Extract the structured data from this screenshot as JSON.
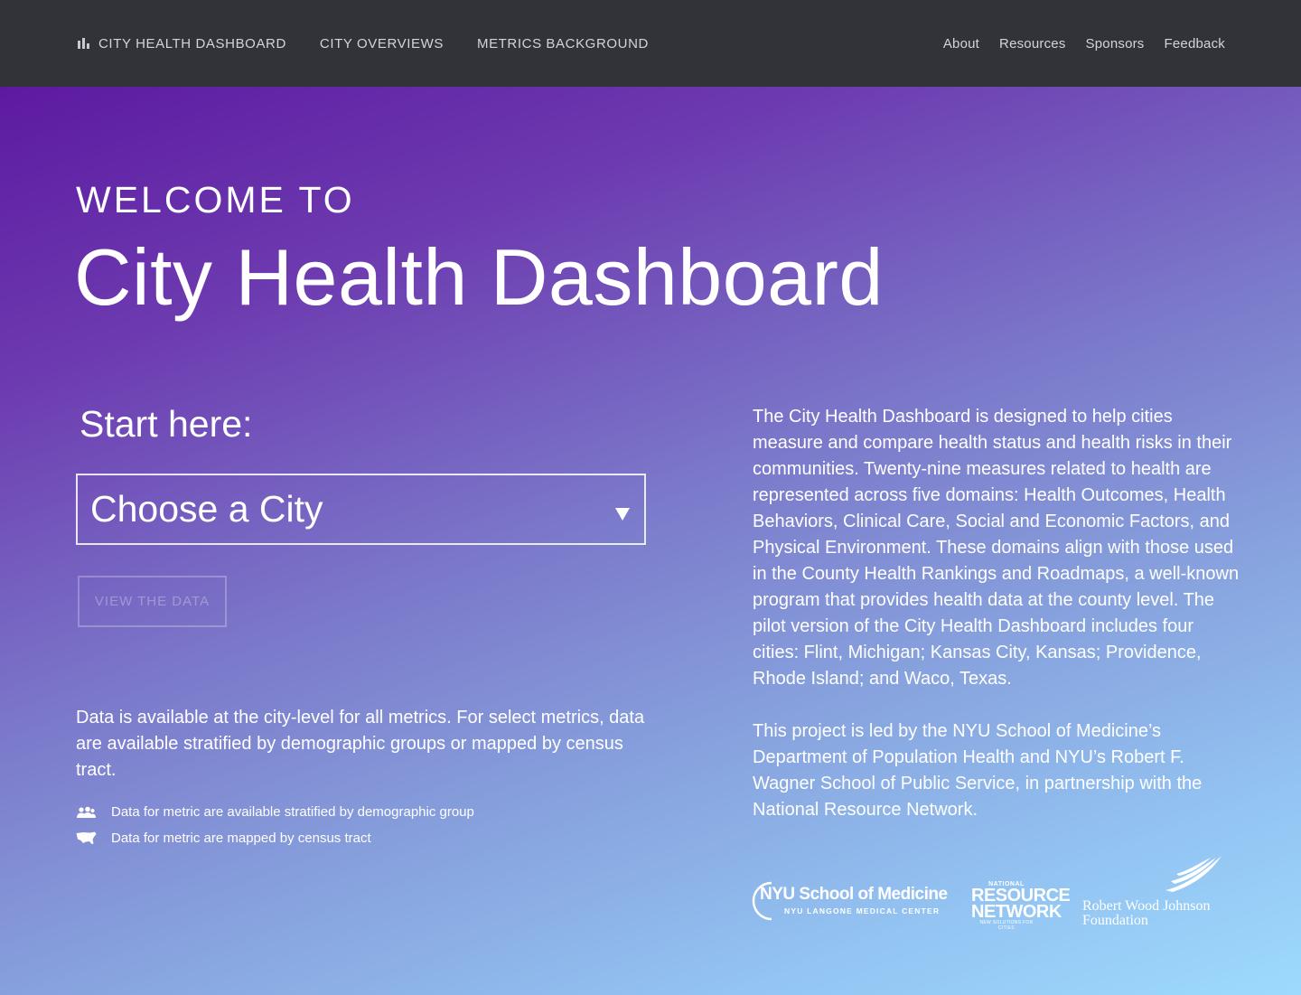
{
  "nav": {
    "brand_icon": "bar-chart-icon",
    "brand_label": "CITY HEALTH DASHBOARD",
    "links_left": [
      "CITY OVERVIEWS",
      "METRICS BACKGROUND"
    ],
    "links_right": [
      "About",
      "Resources",
      "Sponsors",
      "Feedback"
    ]
  },
  "hero": {
    "welcome": "WELCOME TO",
    "title": "City Health Dashboard"
  },
  "selector": {
    "start_label": "Start here:",
    "select_value": "Choose a City",
    "view_button": "VIEW THE DATA"
  },
  "data_note": "Data is available at the city-level for all metrics. For select metrics, data are available stratified by demographic groups or mapped by census tract.",
  "legend": [
    {
      "icon": "people-group-icon",
      "label": "Data for metric are available stratified by demographic group"
    },
    {
      "icon": "us-map-icon",
      "label": "Data for metric are mapped by census tract"
    }
  ],
  "description": {
    "p1": "The City Health Dashboard is designed to help cities measure and compare health status and health risks in their communities. Twenty-nine measures related to health are represented across five domains: Health Outcomes, Health Behaviors, Clinical Care, Social and Economic Factors, and Physical Environment. These domains align with those used in the County Health Rankings and Roadmaps, a well-known program that provides health data at the county level. The pilot version of the City Health Dashboard includes four cities: Flint, Michigan; Kansas City, Kansas; Providence, Rhode Island; and Waco, Texas.",
    "p2": "This project is led by the NYU School of Medicine’s Department of Population Health and NYU’s Robert F. Wagner School of Public Service, in partnership with the National Resource Network."
  },
  "logos": {
    "nyu_main": "NYU School of Medicine",
    "nyu_sub": "NYU LANGONE MEDICAL CENTER",
    "nrn_top": "NATIONAL",
    "nrn_line1": "RESOURCE",
    "nrn_line2": "NETWORK",
    "nrn_bottom": "NEW SOLUTIONS FOR CITIES",
    "rwjf_line1": "Robert Wood Johnson",
    "rwjf_line2": "Foundation"
  },
  "colors": {
    "nav_bg": "#323239",
    "gradient_start": "#5d1aa1",
    "gradient_end": "#9ddafd"
  }
}
